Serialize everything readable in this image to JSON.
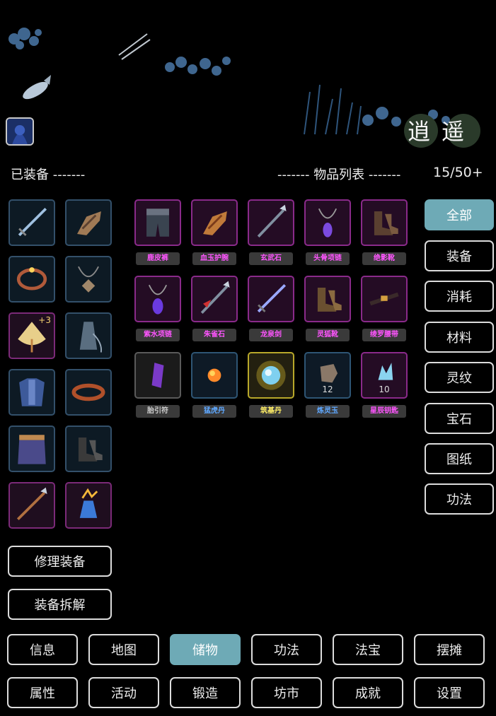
{
  "header": {
    "equipped": "已装备 -------",
    "list": "------- 物品列表 -------",
    "capacity": "15/50+"
  },
  "logo": "逍遥",
  "equipped_slots": [
    {
      "icon": "sword-icon",
      "bonus": ""
    },
    {
      "icon": "gauntlet-icon",
      "bonus": ""
    },
    {
      "icon": "bracelet-icon",
      "bonus": ""
    },
    {
      "icon": "necklace-icon",
      "bonus": ""
    },
    {
      "icon": "fan-icon",
      "bonus": "+3"
    },
    {
      "icon": "robe-icon",
      "bonus": ""
    },
    {
      "icon": "armor-icon",
      "bonus": ""
    },
    {
      "icon": "belt-icon",
      "bonus": ""
    },
    {
      "icon": "leg-armor-icon",
      "bonus": ""
    },
    {
      "icon": "boots-icon",
      "bonus": ""
    },
    {
      "icon": "spear-icon",
      "bonus": ""
    },
    {
      "icon": "vial-icon",
      "bonus": ""
    }
  ],
  "items": [
    {
      "name": "鹿皮裤",
      "icon": "pants-icon",
      "rarity": "purple",
      "qty": ""
    },
    {
      "name": "血玉护腕",
      "icon": "gauntlet-icon",
      "rarity": "purple",
      "qty": ""
    },
    {
      "name": "玄武石",
      "icon": "spear-icon",
      "rarity": "purple",
      "qty": ""
    },
    {
      "name": "头骨项链",
      "icon": "necklace-icon",
      "rarity": "purple",
      "qty": ""
    },
    {
      "name": "绝影靴",
      "icon": "boots-icon",
      "rarity": "purple",
      "qty": ""
    },
    {
      "name": "紫水项链",
      "icon": "necklace-icon",
      "rarity": "purple",
      "qty": ""
    },
    {
      "name": "朱雀石",
      "icon": "spear-icon",
      "rarity": "purple",
      "qty": ""
    },
    {
      "name": "龙泉剑",
      "icon": "sword-icon",
      "rarity": "purple",
      "qty": ""
    },
    {
      "name": "灵狐靴",
      "icon": "boots-icon",
      "rarity": "purple",
      "qty": ""
    },
    {
      "name": "绫罗腰带",
      "icon": "belt-icon",
      "rarity": "purple",
      "qty": ""
    },
    {
      "name": "胎引符",
      "icon": "talisman-icon",
      "rarity": "gray",
      "qty": ""
    },
    {
      "name": "猛虎丹",
      "icon": "pill-icon",
      "rarity": "blue",
      "qty": ""
    },
    {
      "name": "筑基丹",
      "icon": "orb-icon",
      "rarity": "gold",
      "qty": ""
    },
    {
      "name": "炼灵玉",
      "icon": "stone-icon",
      "rarity": "blue",
      "qty": "12"
    },
    {
      "name": "星辰钥匙",
      "icon": "crystal-icon",
      "rarity": "purple",
      "qty": "10"
    }
  ],
  "categories": [
    "全部",
    "装备",
    "消耗",
    "材料",
    "灵纹",
    "宝石",
    "图纸",
    "功法"
  ],
  "actions": {
    "repair": "修理装备",
    "dismantle": "装备拆解"
  },
  "nav_row1": [
    "信息",
    "地图",
    "储物",
    "功法",
    "法宝",
    "摆摊"
  ],
  "nav_row2": [
    "属性",
    "活动",
    "锻造",
    "坊市",
    "成就",
    "设置"
  ],
  "colors": {
    "accent": "#6eaab6",
    "purple_label": "#ff55ff",
    "blue_label": "#5fa8ff",
    "gold_label": "#ffee66",
    "gray_label": "#cccccc"
  }
}
